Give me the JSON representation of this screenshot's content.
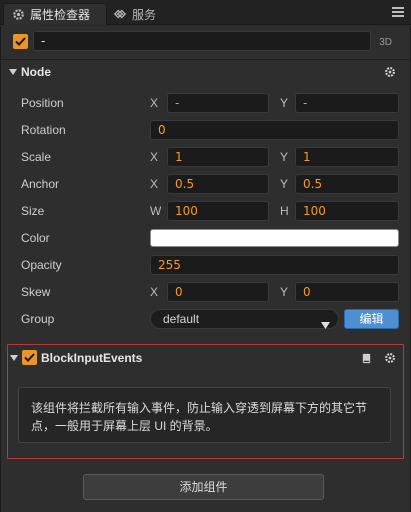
{
  "tabs": [
    {
      "label": "属性检查器",
      "icon": "gear-icon"
    },
    {
      "label": "服务",
      "icon": "link-icon"
    }
  ],
  "node": {
    "name_value": "-",
    "mode_tag": "3D",
    "enabled": true
  },
  "node_section": {
    "title": "Node",
    "rows": {
      "position": {
        "label": "Position",
        "x_axis": "X",
        "x_value": "-",
        "y_axis": "Y",
        "y_value": "-"
      },
      "rotation": {
        "label": "Rotation",
        "value": "0"
      },
      "scale": {
        "label": "Scale",
        "x_axis": "X",
        "x_value": "1",
        "y_axis": "Y",
        "y_value": "1"
      },
      "anchor": {
        "label": "Anchor",
        "x_axis": "X",
        "x_value": "0.5",
        "y_axis": "Y",
        "y_value": "0.5"
      },
      "size": {
        "label": "Size",
        "w_axis": "W",
        "w_value": "100",
        "h_axis": "H",
        "h_value": "100"
      },
      "color": {
        "label": "Color",
        "value_hex": "#ffffff"
      },
      "opacity": {
        "label": "Opacity",
        "value": "255"
      },
      "skew": {
        "label": "Skew",
        "x_axis": "X",
        "x_value": "0",
        "y_axis": "Y",
        "y_value": "0"
      },
      "group": {
        "label": "Group",
        "value": "default",
        "edit_label": "编辑"
      }
    }
  },
  "component": {
    "title": "BlockInputEvents",
    "enabled": true,
    "description_line1": "该组件将拦截所有输入事件，防止输入穿透到屏幕下方的其它节",
    "description_line2": "点，一般用于屏幕上层 UI 的背景。"
  },
  "add_component_label": "添加组件",
  "colors": {
    "accent_orange": "#e7952c",
    "value_orange": "#f39a2b",
    "highlight_red": "#b23a3a",
    "button_blue": "#4d8fd0"
  }
}
